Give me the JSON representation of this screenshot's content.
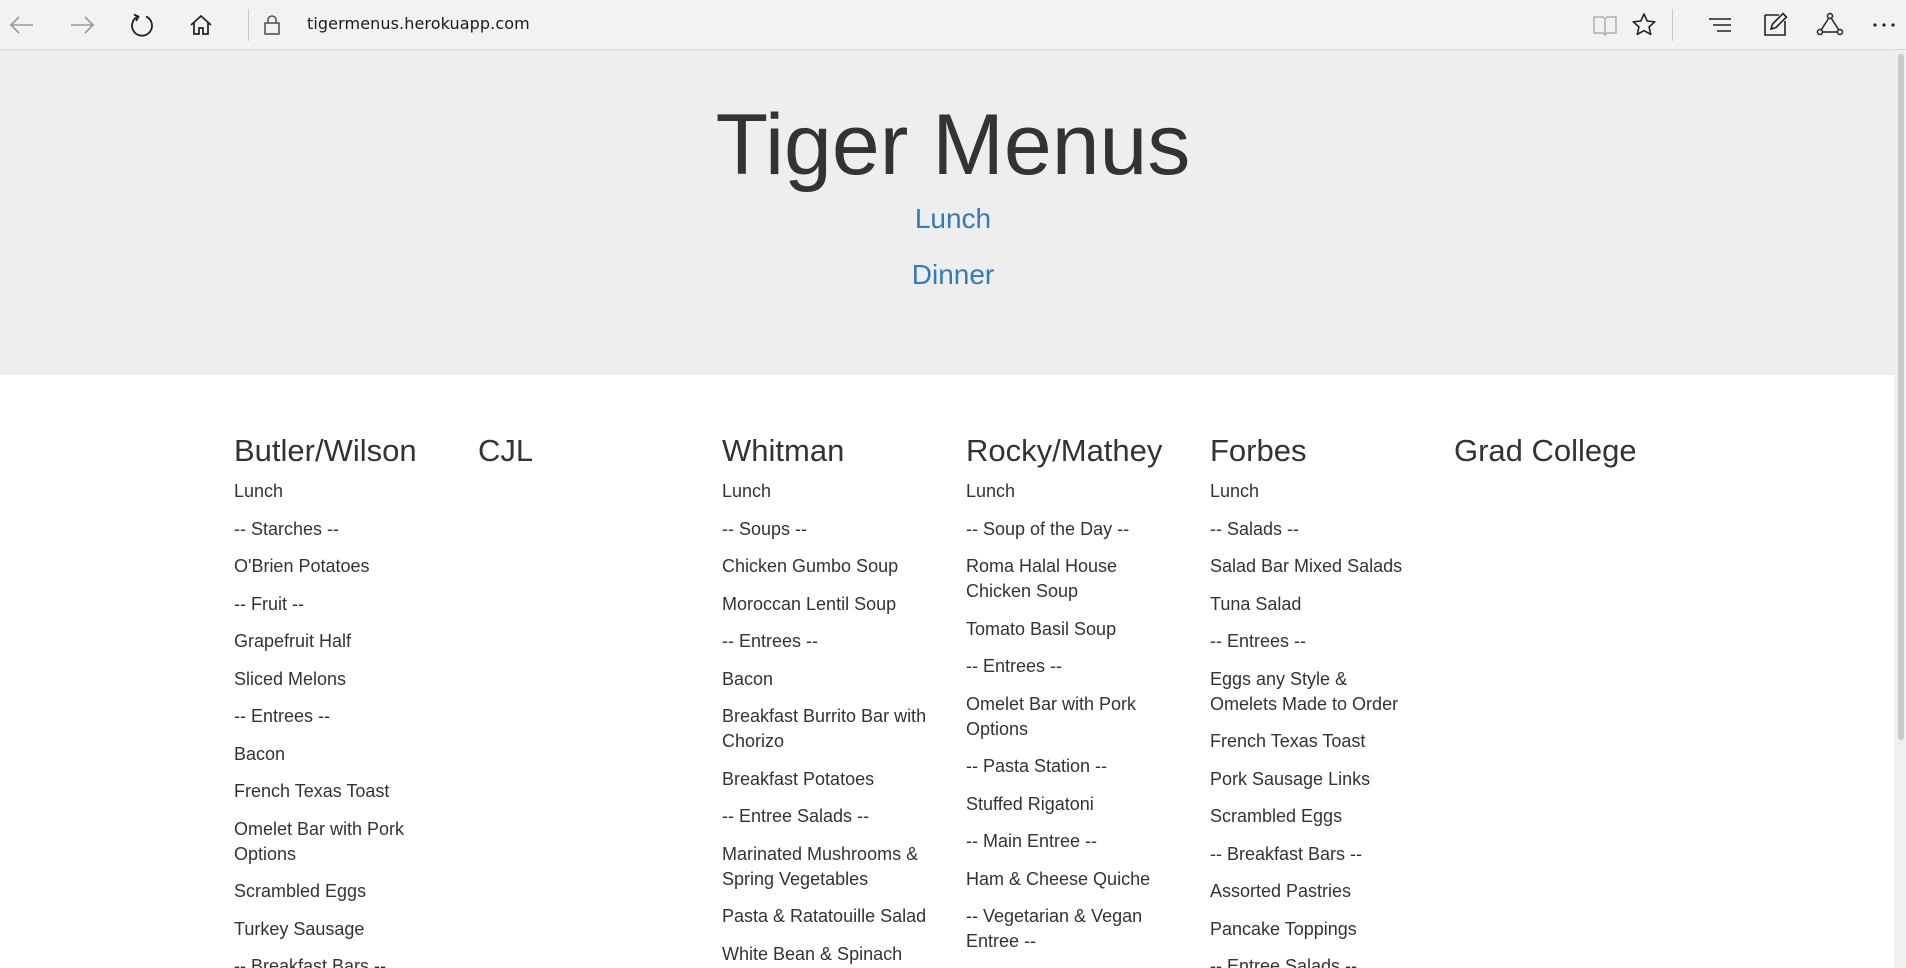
{
  "browser": {
    "url": "tigermenus.herokuapp.com",
    "icons": [
      "back-arrow-icon",
      "forward-arrow-icon",
      "refresh-icon",
      "home-icon",
      "lock-icon",
      "reading-view-icon",
      "favorite-star-icon",
      "hub-icon",
      "web-note-icon",
      "share-icon",
      "more-icon"
    ]
  },
  "header": {
    "title": "Tiger Menus",
    "links": [
      "Lunch",
      "Dinner"
    ],
    "link_color": "#337ab7"
  },
  "halls": [
    {
      "name": "Butler/Wilson",
      "meal": "Lunch",
      "items": [
        "-- Starches --",
        "O'Brien Potatoes",
        "-- Fruit --",
        "Grapefruit Half",
        "Sliced Melons",
        "-- Entrees --",
        "Bacon",
        "French Texas Toast",
        "Omelet Bar with Pork Options",
        "Scrambled Eggs",
        "Turkey Sausage",
        "-- Breakfast Bars --"
      ]
    },
    {
      "name": "CJL",
      "meal": "",
      "items": []
    },
    {
      "name": "Whitman",
      "meal": "Lunch",
      "items": [
        "-- Soups --",
        "Chicken Gumbo Soup",
        "Moroccan Lentil Soup",
        "-- Entrees --",
        "Bacon",
        "Breakfast Burrito Bar with Chorizo",
        "Breakfast Potatoes",
        "-- Entree Salads --",
        "Marinated Mushrooms & Spring Vegetables",
        "Pasta & Ratatouille Salad",
        "White Bean & Spinach"
      ]
    },
    {
      "name": "Rocky/Mathey",
      "meal": "Lunch",
      "items": [
        "-- Soup of the Day --",
        "Roma Halal House Chicken Soup",
        "Tomato Basil Soup",
        "-- Entrees --",
        "Omelet Bar with Pork Options",
        "-- Pasta Station --",
        "Stuffed Rigatoni",
        "-- Main Entree --",
        "Ham & Cheese Quiche",
        "-- Vegetarian & Vegan Entree --"
      ]
    },
    {
      "name": "Forbes",
      "meal": "Lunch",
      "items": [
        "-- Salads --",
        "Salad Bar Mixed Salads",
        "Tuna Salad",
        "-- Entrees --",
        "Eggs any Style & Omelets Made to Order",
        "French Texas Toast",
        "Pork Sausage Links",
        "Scrambled Eggs",
        "-- Breakfast Bars --",
        "Assorted Pastries",
        "Pancake Toppings",
        "-- Entree Salads --"
      ]
    },
    {
      "name": "Grad College",
      "meal": "",
      "items": []
    }
  ]
}
